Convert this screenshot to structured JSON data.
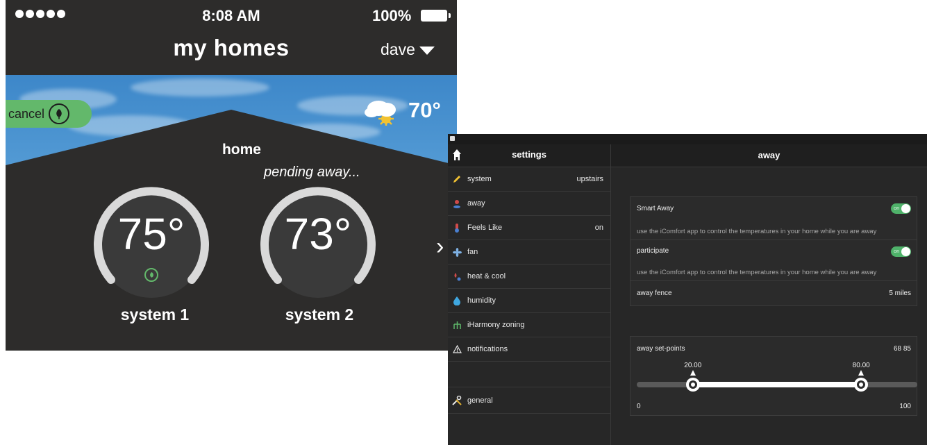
{
  "phone": {
    "status_bar": {
      "time": "8:08 AM",
      "battery": "100%"
    },
    "title": "my homes",
    "user": "dave",
    "cancel_label": "cancel",
    "outdoor_temp": "70°",
    "home": {
      "name": "home",
      "status": "pending away..."
    },
    "systems": [
      {
        "name": "system 1",
        "temp": "75°",
        "level": 0.78
      },
      {
        "name": "system 2",
        "temp": "73°",
        "level": 0.78
      }
    ],
    "colors": {
      "panel": "#2d2c2b",
      "sky": "#5ea4da",
      "dial_track": "#d9d9d9",
      "accent_green": "#63b86b"
    }
  },
  "settings": {
    "sidebar_title": "settings",
    "main_title": "away",
    "items": [
      {
        "label": "system",
        "value": "upstairs",
        "icon": "pencil-icon"
      },
      {
        "label": "away",
        "value": "",
        "icon": "person-pin-icon"
      },
      {
        "label": "Feels Like",
        "value": "on",
        "icon": "thermometer-icon"
      },
      {
        "label": "fan",
        "value": "",
        "icon": "fan-icon"
      },
      {
        "label": "heat & cool",
        "value": "",
        "icon": "heat-cool-icon"
      },
      {
        "label": "humidity",
        "value": "",
        "icon": "droplet-icon"
      },
      {
        "label": "iHarmony zoning",
        "value": "",
        "icon": "zoning-icon"
      },
      {
        "label": "notifications",
        "value": "",
        "icon": "warning-icon"
      },
      {
        "label": "general",
        "value": "",
        "icon": "tools-icon"
      }
    ],
    "smart_away": {
      "label": "Smart Away",
      "toggle": "on",
      "description": "use the iComfort app to control the temperatures in your home while you are away"
    },
    "participate": {
      "label": "participate",
      "toggle": "on",
      "description": "use the iComfort app to control the temperatures in your home while you are away"
    },
    "away_fence": {
      "label": "away fence",
      "value": "5 miles"
    },
    "setpoints": {
      "label": "away set-points",
      "summary": "68 85",
      "min_value": "20.00",
      "max_value": "80.00",
      "range_min": "0",
      "range_max": "100",
      "low": 20,
      "high": 80
    }
  }
}
